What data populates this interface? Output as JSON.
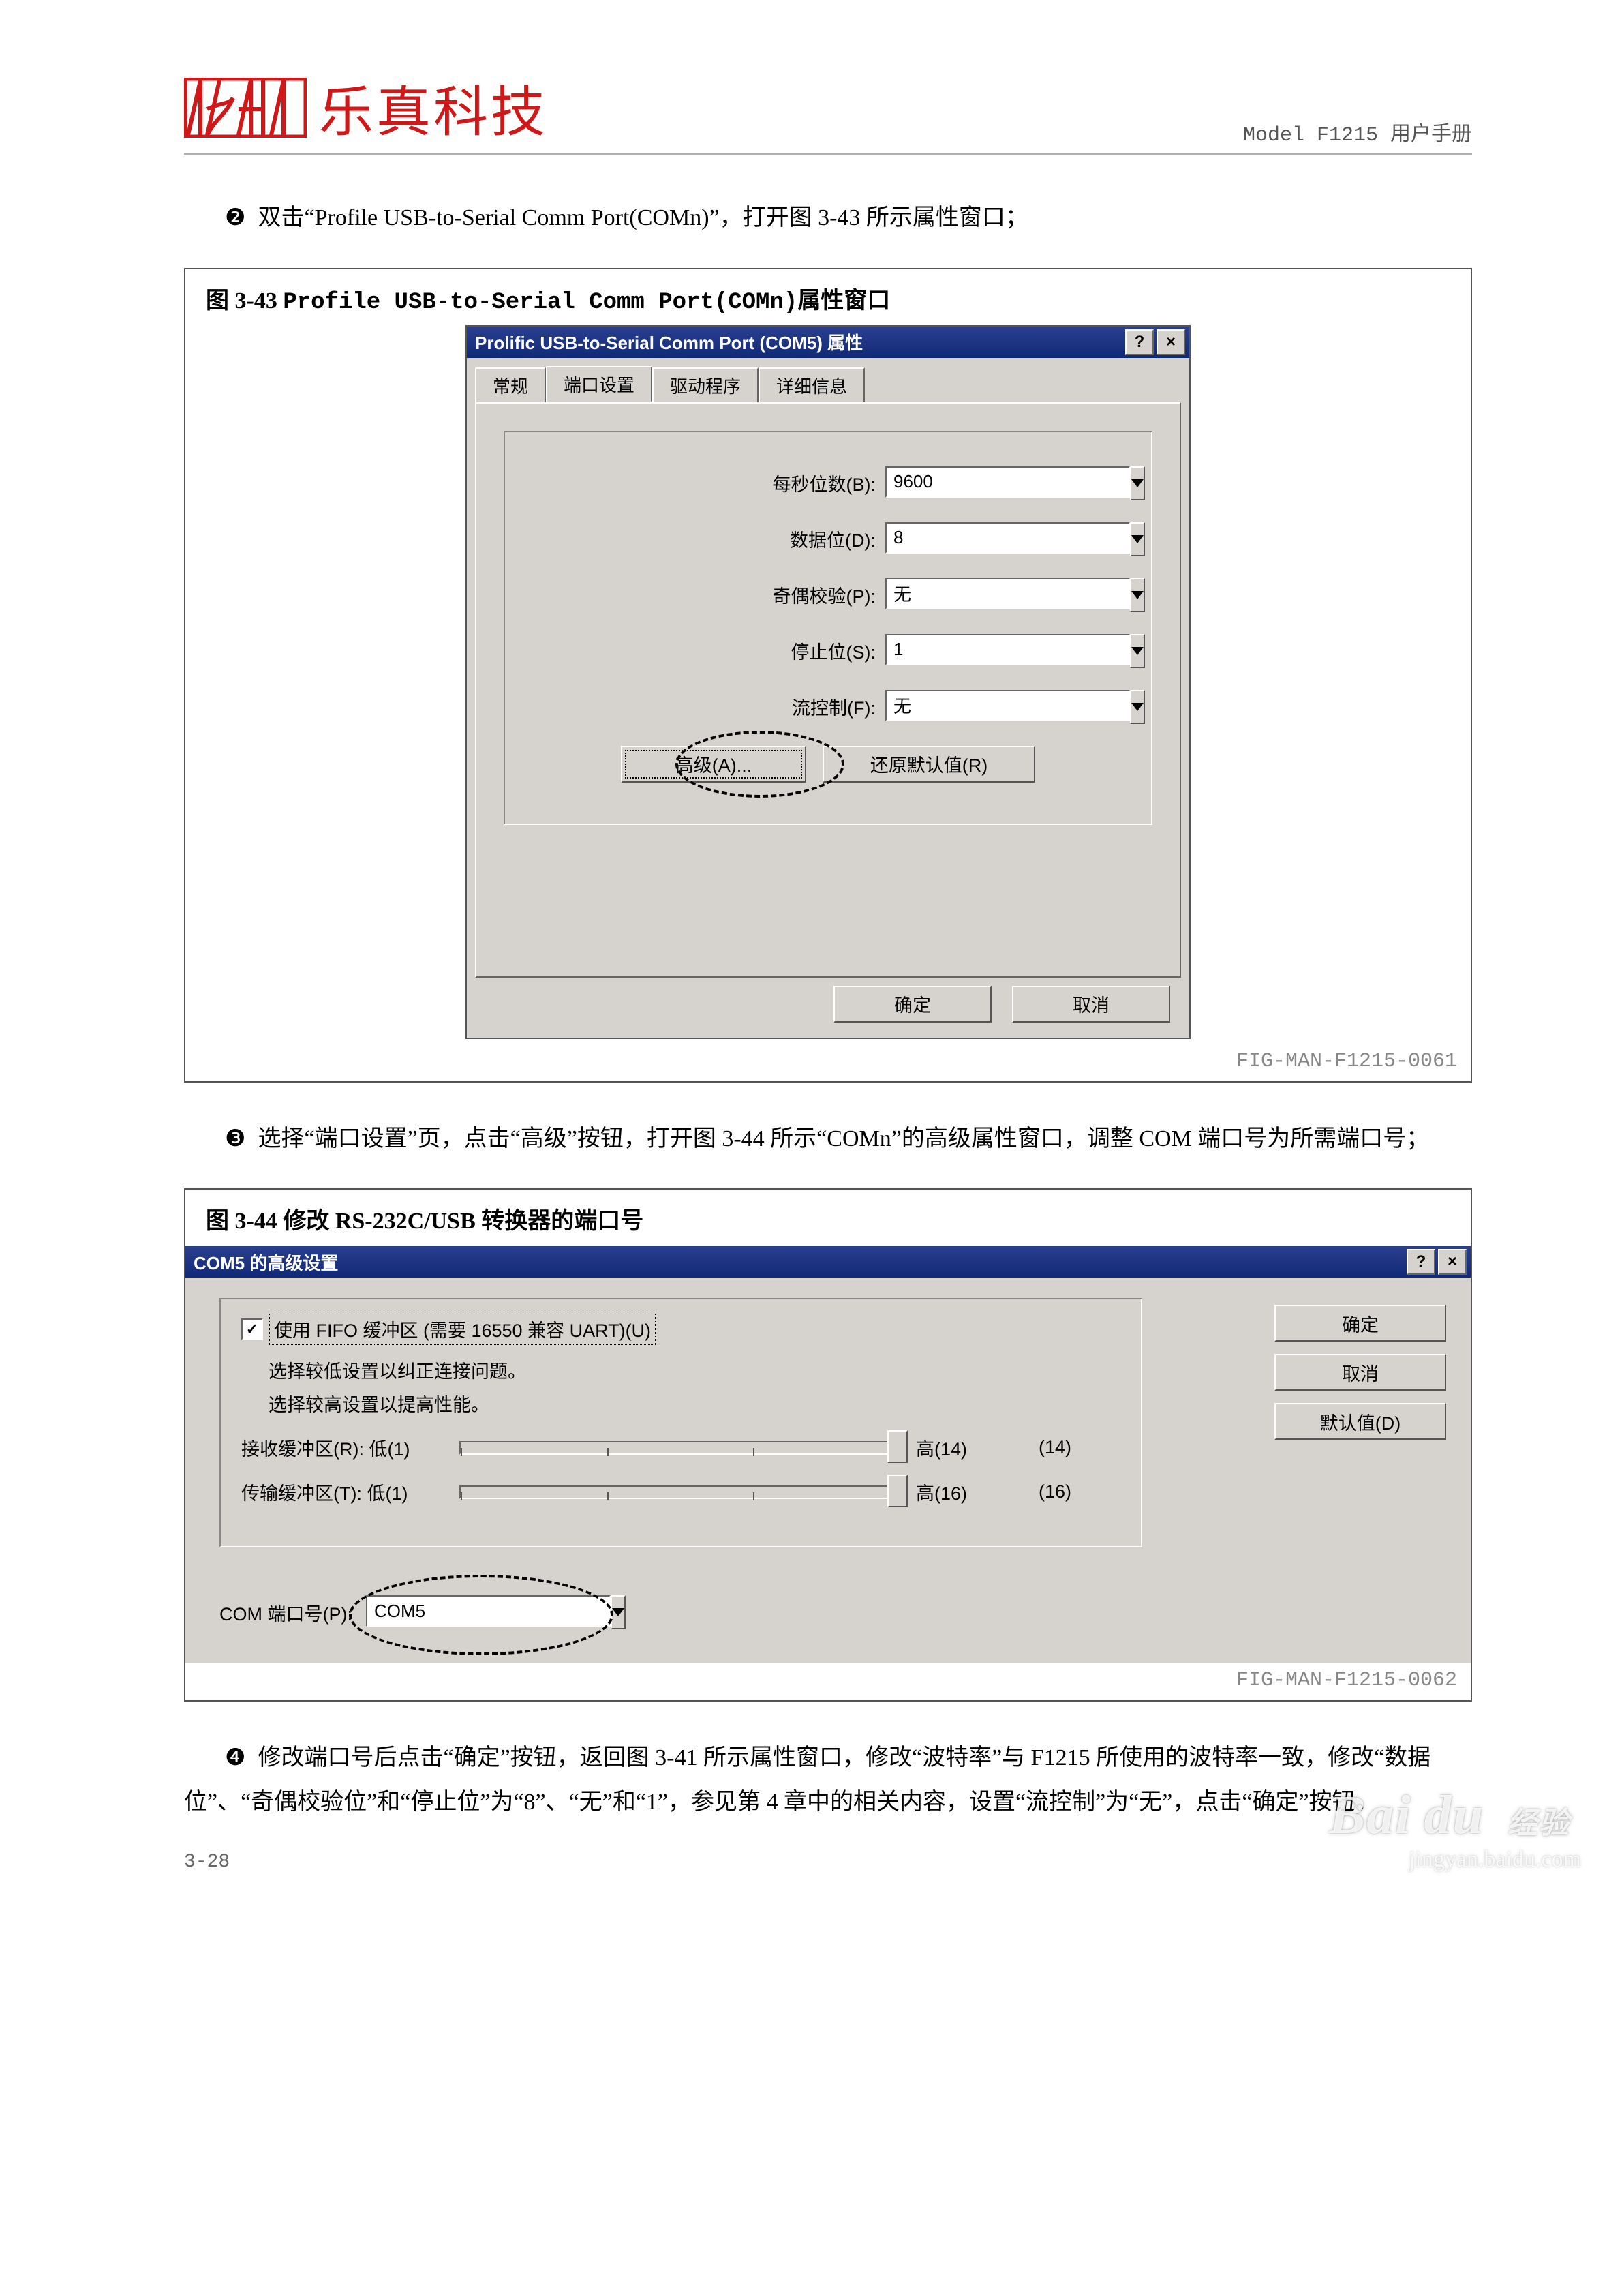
{
  "header": {
    "brand_cn": "乐真科技",
    "manual": "Model F1215 用户手册"
  },
  "steps": {
    "s2": "双击“Profile USB-to-Serial Comm Port(COMn)”，打开图 3-43 所示属性窗口；",
    "s3": "选择“端口设置”页，点击“高级”按钮，打开图 3-44 所示“COMn”的高级属性窗口，调整 COM 端口号为所需端口号；",
    "s4": "修改端口号后点击“确定”按钮，返回图 3-41 所示属性窗口，修改“波特率”与 F1215 所使用的波特率一致，修改“数据位”、“奇偶校验位”和“停止位”为“8”、“无”和“1”，参见第 4 章中的相关内容，设置“流控制”为“无”，点击“确定”按钮。"
  },
  "fig1": {
    "caption_pre": "图 3-43 ",
    "caption_mono": "Profile USB-to-Serial Comm Port(COMn)",
    "caption_post": "属性窗口",
    "title": "Prolific USB-to-Serial Comm Port (COM5) 属性",
    "tabs": {
      "t0": "常规",
      "t1": "端口设置",
      "t2": "驱动程序",
      "t3": "详细信息"
    },
    "fields": {
      "baud_label": "每秒位数(B):",
      "baud_val": "9600",
      "data_label": "数据位(D):",
      "data_val": "8",
      "parity_label": "奇偶校验(P):",
      "parity_val": "无",
      "stop_label": "停止位(S):",
      "stop_val": "1",
      "flow_label": "流控制(F):",
      "flow_val": "无"
    },
    "adv_btn": "高级(A)...",
    "restore_btn": "还原默认值(R)",
    "ok": "确定",
    "cancel": "取消",
    "footer": "FIG-MAN-F1215-0061"
  },
  "fig2": {
    "caption": "图 3-44 修改 RS-232C/USB 转换器的端口号",
    "title": "COM5 的高级设置",
    "chk_label": "使用 FIFO 缓冲区 (需要 16550 兼容 UART)(U)",
    "hint1": "选择较低设置以纠正连接问题。",
    "hint2": "选择较高设置以提高性能。",
    "rx_label": "接收缓冲区(R): 低(1)",
    "rx_high": "高(14)",
    "rx_val": "(14)",
    "tx_label": "传输缓冲区(T): 低(1)",
    "tx_high": "高(16)",
    "tx_val": "(16)",
    "comport_label": "COM 端口号(P):",
    "comport_val": "COM5",
    "ok": "确定",
    "cancel": "取消",
    "defaults": "默认值(D)",
    "footer": "FIG-MAN-F1215-0062"
  },
  "page_num": "3-28",
  "watermark": {
    "big1": "Bai",
    "big2": "du",
    "tag": "经验",
    "url": "jingyan.baidu.com"
  }
}
